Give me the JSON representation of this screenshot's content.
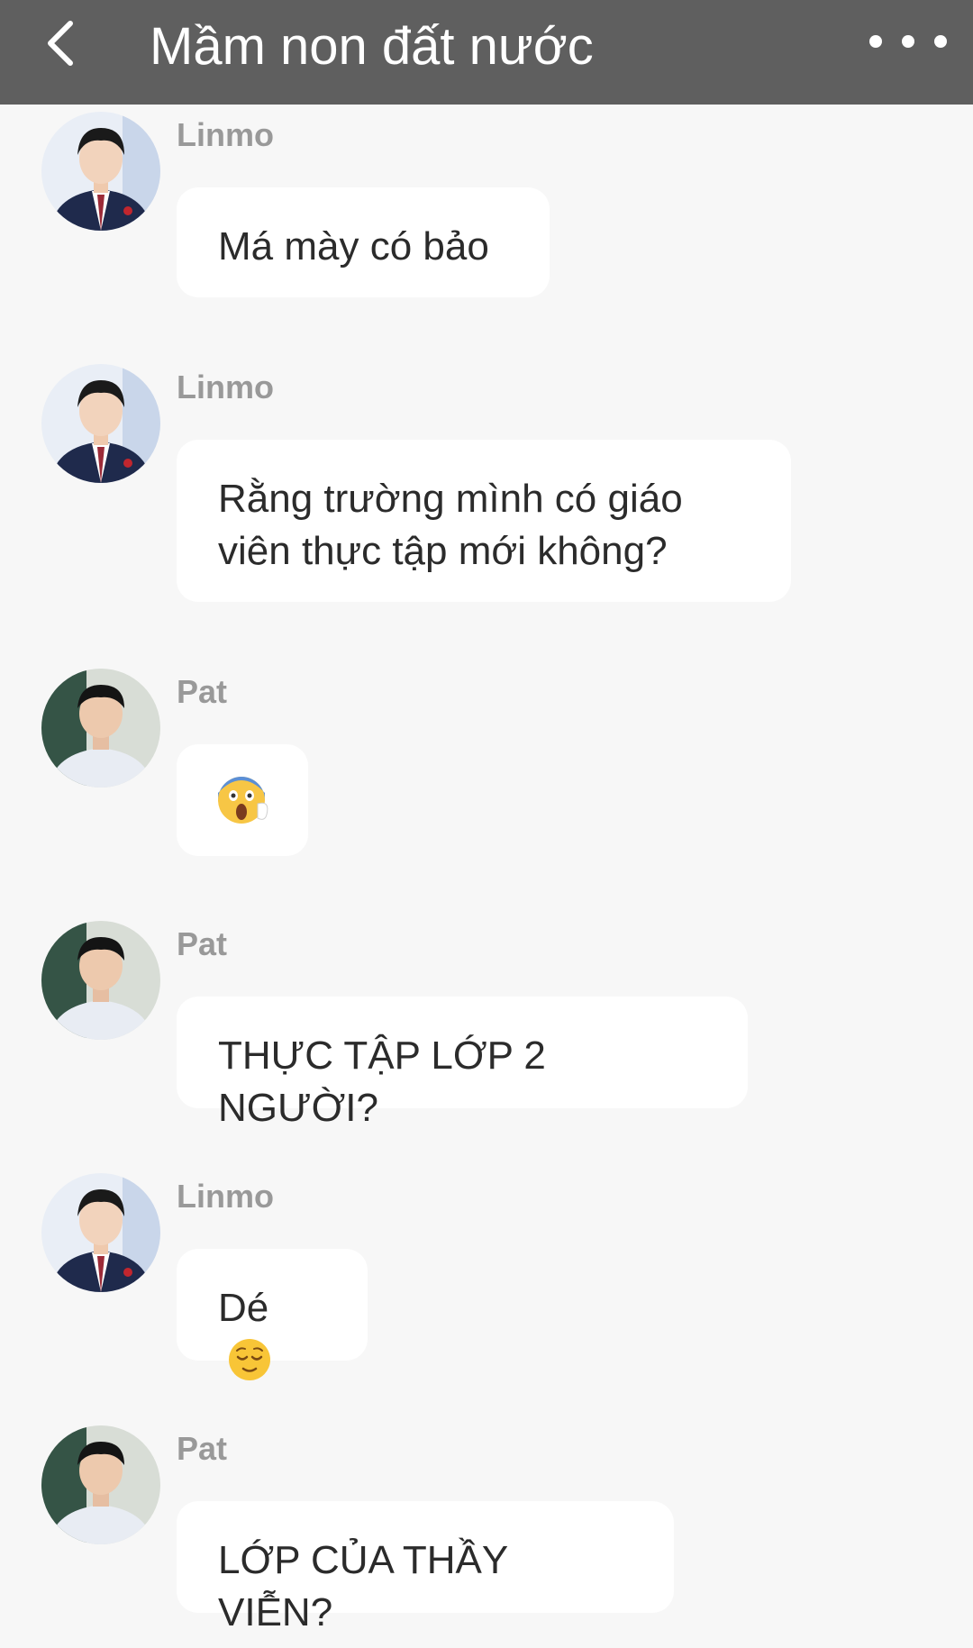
{
  "header": {
    "title": "Mầm non đất nước",
    "back_icon": "chevron-left-icon",
    "more_icon": "more-dots-icon"
  },
  "messages": [
    {
      "sender": "Linmo",
      "text": "Má mày có bảo",
      "avatar": "avatar-linmo"
    },
    {
      "sender": "Linmo",
      "text": "Rằng trường mình có giáo viên thực tập mới không?",
      "avatar": "avatar-linmo"
    },
    {
      "sender": "Pat",
      "text": "",
      "emoji": "screaming-face-emoji",
      "avatar": "avatar-pat"
    },
    {
      "sender": "Pat",
      "text": "THỰC TẬP LỚP 2 NGƯỜI?",
      "avatar": "avatar-pat"
    },
    {
      "sender": "Linmo",
      "text": "Dé",
      "emoji": "relieved-face-emoji",
      "avatar": "avatar-linmo"
    },
    {
      "sender": "Pat",
      "text": "LỚP CỦA THẦY VIỄN?",
      "avatar": "avatar-pat"
    }
  ],
  "colors": {
    "header_bg": "#5f5f5f",
    "page_bg": "#f7f7f7",
    "bubble_bg": "#ffffff",
    "sender_text": "#999999"
  }
}
